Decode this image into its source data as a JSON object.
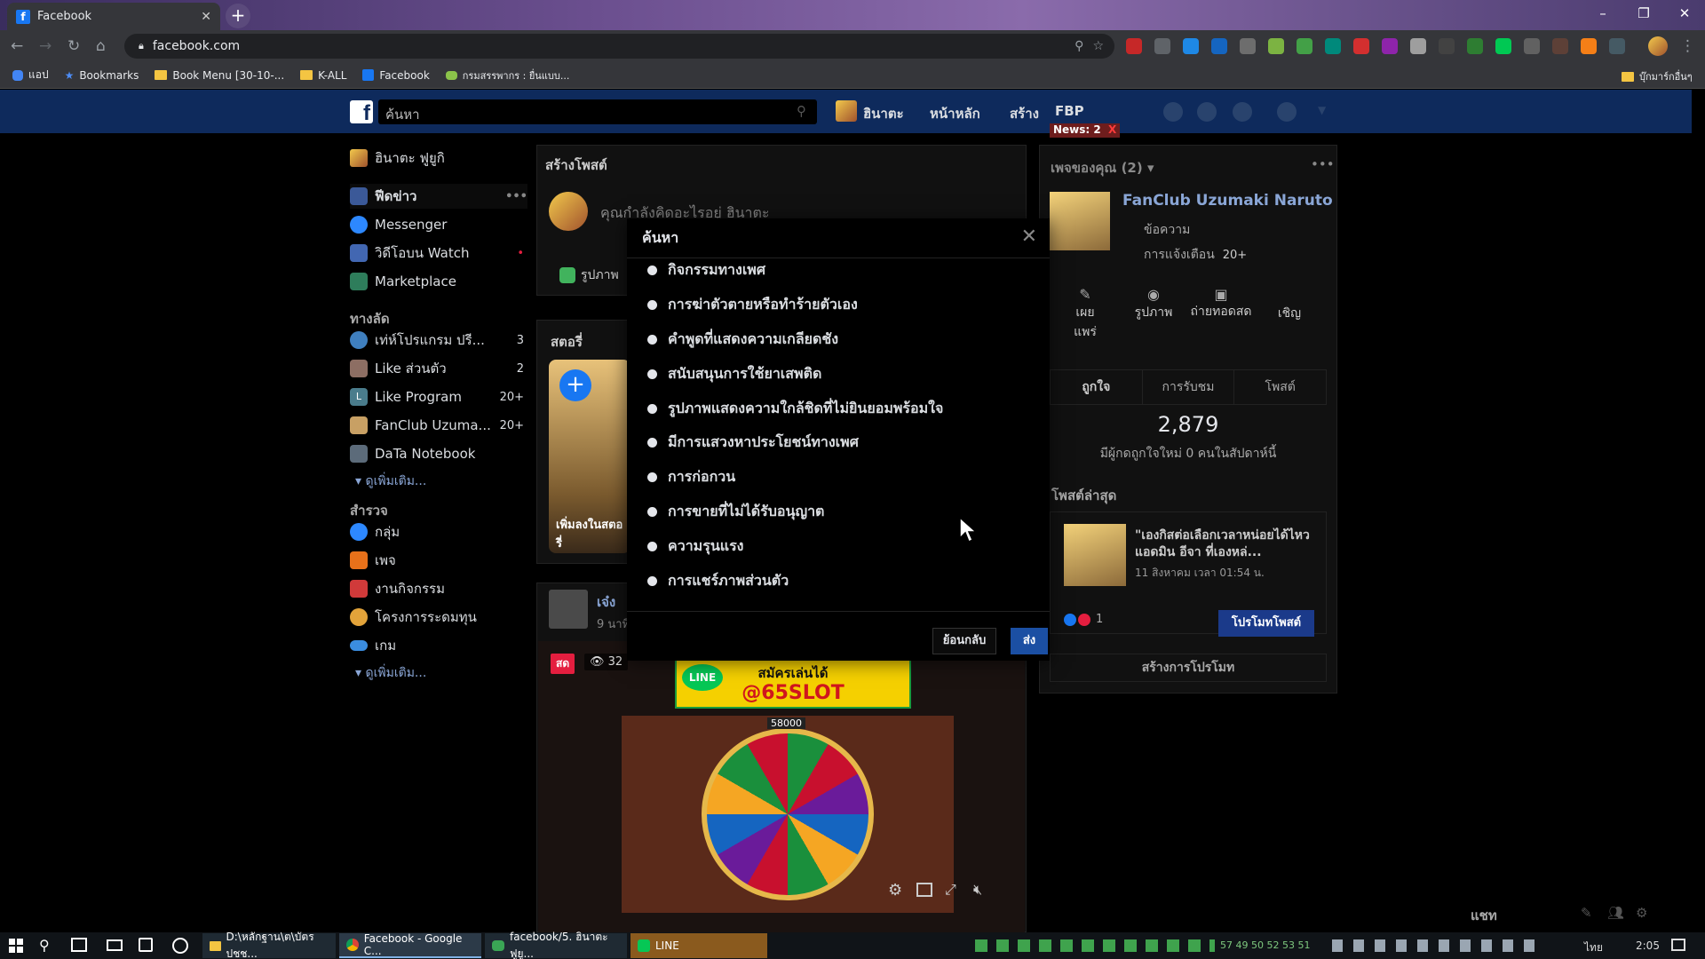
{
  "browser": {
    "tab_title": "Facebook",
    "new_tab_label": "+",
    "url": "facebook.com",
    "window_controls": [
      "–",
      "❐",
      "✕"
    ]
  },
  "bookmarks": [
    {
      "label": "แอป",
      "icon": "apps-icon"
    },
    {
      "label": "Bookmarks",
      "icon": "star-icon"
    },
    {
      "label": "Book Menu [30-10-...",
      "icon": "folder-icon"
    },
    {
      "label": "K-ALL",
      "icon": "folder-icon"
    },
    {
      "label": "Facebook",
      "icon": "facebook-icon"
    },
    {
      "label": "กรมสรรพากร : ยื่นแบบ...",
      "icon": "page-icon"
    }
  ],
  "bookmarks_right": "บุ๊กมาร์กอื่นๆ",
  "fb_header": {
    "logo": "f",
    "search_placeholder": "ค้นหา",
    "user_name": "ฮินาตะ",
    "home": "หน้าหลัก",
    "create": "สร้าง",
    "fbp": "FBP",
    "news_badge": "News: 2",
    "news_close": "X"
  },
  "left_sidebar": {
    "profile_name": "ฮินาตะ ฟูยูกิ",
    "main": [
      {
        "label": "ฟีดข่าว",
        "count": ""
      },
      {
        "label": "Messenger",
        "count": ""
      },
      {
        "label": "วิดีโอบน Watch",
        "count": "•"
      },
      {
        "label": "Marketplace",
        "count": ""
      }
    ],
    "shortcuts_title": "ทางลัด",
    "shortcuts": [
      {
        "label": "เท่ห์โปรแกรม ปรี...",
        "count": "3"
      },
      {
        "label": "Like ส่วนตัว",
        "count": "2"
      },
      {
        "label": "Like Program",
        "count": "20+"
      },
      {
        "label": "FanClub Uzuma...",
        "count": "20+"
      },
      {
        "label": "DaTa Notebook",
        "count": ""
      }
    ],
    "see_more": "ดูเพิ่มเติม...",
    "explore_title": "สำรวจ",
    "explore": [
      {
        "label": "กลุ่ม"
      },
      {
        "label": "เพจ"
      },
      {
        "label": "งานกิจกรรม"
      },
      {
        "label": "โครงการระดมทุน"
      },
      {
        "label": "เกม"
      }
    ],
    "see_more_2": "ดูเพิ่มเติม..."
  },
  "feed": {
    "create_post_title": "สร้างโพสต์",
    "composer_placeholder": "คุณกำลังคิดอะไรอยู่ ฮินาตะ",
    "photo_label": "รูปภาพ",
    "stories_title": "สตอรี่",
    "story_add": "+",
    "story_caption": "เพิ่มลงในสตอรี่",
    "post_author": "เจ๋ง",
    "post_time": "9 นาที",
    "live_badge": "สด",
    "viewers": "32",
    "video_banner_line": "LINE",
    "video_banner_top": "สมัครเล่นได้",
    "video_banner_main": "@65SLOT",
    "video_score": "58000"
  },
  "right_column": {
    "pages_title": "เพจของคุณ (2)",
    "page_name": "FanClub Uzumaki Naruto",
    "messages": "ข้อความ",
    "notifications": "การแจ้งเตือน",
    "notifications_count": "20+",
    "actions": [
      {
        "label": "เผยแพร่"
      },
      {
        "label": "รูปภาพ"
      },
      {
        "label": "ถ่ายทอดสด"
      },
      {
        "label": "เชิญ"
      }
    ],
    "tabs": [
      "ถูกใจ",
      "การรับชม",
      "โพสต์"
    ],
    "likes_total": "2,879",
    "likes_note": "มีผู้กดถูกใจใหม่ 0 คนในสัปดาห์นี้",
    "recent_posts_title": "โพสต์ล่าสุด",
    "recent_post_text": "\"เองกิสต่อเลือกเวลาหน่อยได้ไหว แอดมิน อีจา ที่เองหล่...",
    "recent_post_time": "11 สิงหาคม เวลา 01:54 น.",
    "reactions_count": "1",
    "promote_button": "โปรโมทโพสต์",
    "create_promo": "สร้างการโปรโมท"
  },
  "chat": {
    "label": "แชท"
  },
  "modal": {
    "title": "ค้นหา",
    "options": [
      "กิจกรรมทางเพศ",
      "การฆ่าตัวตายหรือทำร้ายตัวเอง",
      "คำพูดที่แสดงความเกลียดชัง",
      "สนับสนุนการใช้ยาเสพติด",
      "รูปภาพแสดงความใกล้ชิดที่ไม่ยินยอมพร้อมใจ",
      "มีการแสวงหาประโยชน์ทางเพศ",
      "การก่อกวน",
      "การขายที่ไม่ได้รับอนุญาต",
      "ความรุนแรง",
      "การแชร์ภาพส่วนตัว"
    ],
    "back_button": "ย้อนกลับ",
    "send_button": "ส่ง"
  },
  "taskbar": {
    "tasks": [
      {
        "label": "D:\\หลักฐาน\\ต\\บัตร ปชช..."
      },
      {
        "label": "Facebook - Google C..."
      },
      {
        "label": "facebook/5. ฮินาตะ ฟูยู..."
      },
      {
        "label": "LINE"
      }
    ],
    "tray_numbers": "57  49  50  52  53  51",
    "language": "ไทย",
    "clock": "2:05"
  }
}
